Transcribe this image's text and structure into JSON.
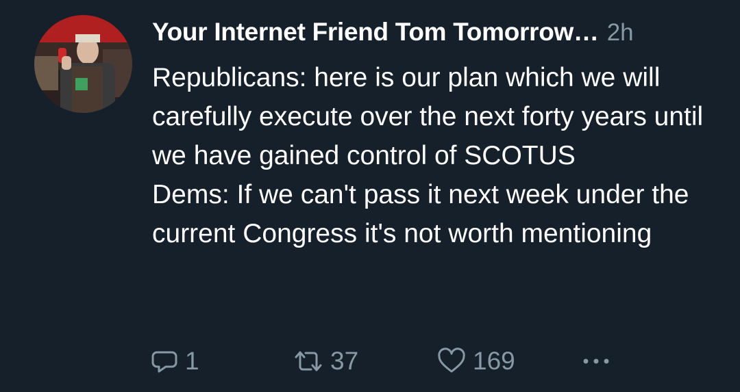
{
  "tweet": {
    "author_name": "Your Internet Friend Tom Tomorrow…",
    "timestamp": "2h",
    "paragraphs": [
      "Republicans: here is our plan which we will carefully execute over the next forty years until we have gained control of SCOTUS",
      "Dems: If we can't pass it next week under the current Congress it's not worth mentioning"
    ],
    "actions": {
      "reply": {
        "icon": "reply-icon",
        "count": "1"
      },
      "retweet": {
        "icon": "retweet-icon",
        "count": "37"
      },
      "like": {
        "icon": "heart-icon",
        "count": "169"
      },
      "more": {
        "icon": "more-icon"
      }
    }
  },
  "colors": {
    "background": "#15202b",
    "primary_text": "#ffffff",
    "secondary_text": "#8899a6"
  }
}
